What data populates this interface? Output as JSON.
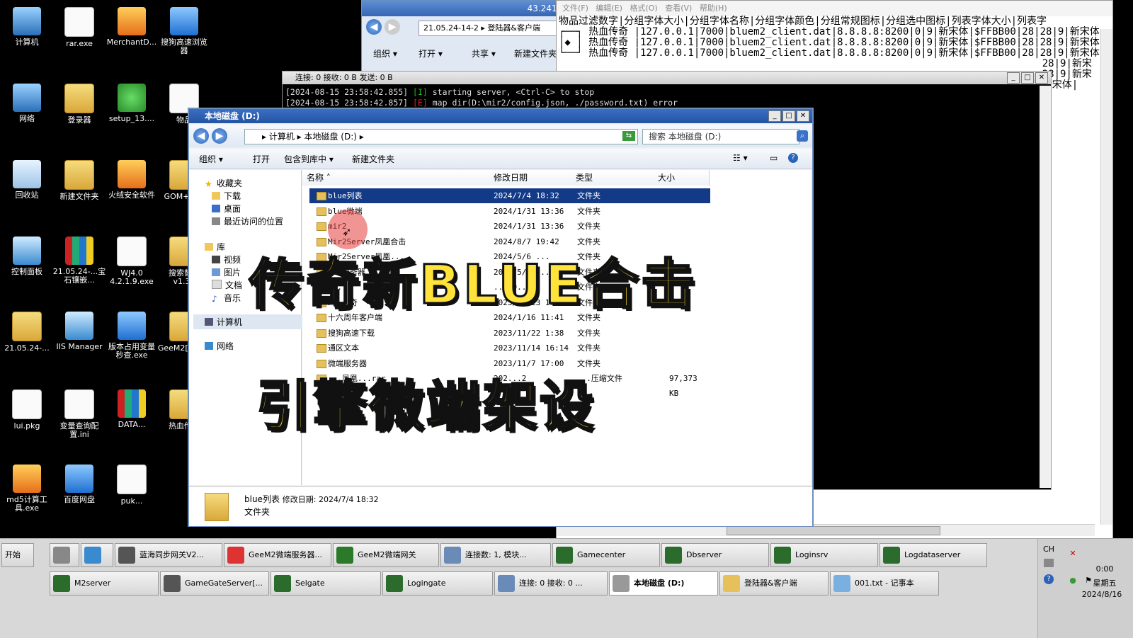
{
  "desktop_icons": [
    {
      "label": "计算机",
      "icon": "computer-icon"
    },
    {
      "label": "rar.exe",
      "icon": "exe-icon"
    },
    {
      "label": "MerchantD...",
      "icon": "app-icon"
    },
    {
      "label": "搜狗高速浏览器",
      "icon": "sogou-browser-icon"
    },
    {
      "label": "网络",
      "icon": "network-icon"
    },
    {
      "label": "登录器",
      "icon": "folder-icon"
    },
    {
      "label": "setup_13....",
      "icon": "installer-icon"
    },
    {
      "label": "物品",
      "icon": "document-icon"
    },
    {
      "label": "回收站",
      "icon": "recycle-bin-icon"
    },
    {
      "label": "新建文件夹",
      "icon": "folder-icon"
    },
    {
      "label": "火绒安全软件",
      "icon": "huorong-icon"
    },
    {
      "label": "GOM+201",
      "icon": "folder-icon"
    },
    {
      "label": "控制面板",
      "icon": "control-panel-icon"
    },
    {
      "label": "21.05.24-...宝石镶嵌...",
      "icon": "rar-icon"
    },
    {
      "label": "WJ4.0 4.2.1.9.exe",
      "icon": "yinyang-icon"
    },
    {
      "label": "搜索替换 v1.32",
      "icon": "folder-icon"
    },
    {
      "label": "21.05.24-...",
      "icon": "folder-icon"
    },
    {
      "label": "IIS Manager",
      "icon": "iis-icon"
    },
    {
      "label": "版本占用变量秒查.exe",
      "icon": "apple-icon"
    },
    {
      "label": "GeeM2[202...",
      "icon": "folder-icon"
    },
    {
      "label": "lui.pkg",
      "icon": "document-icon"
    },
    {
      "label": "变量查询配置.ini",
      "icon": "settings-file-icon"
    },
    {
      "label": "DATA...",
      "icon": "rar-icon"
    },
    {
      "label": "热血传奇",
      "icon": "folder-icon"
    },
    {
      "label": "md5计算工具.exe",
      "icon": "md5-tool-icon"
    },
    {
      "label": "百度网盘",
      "icon": "baidu-netdisk-icon"
    },
    {
      "label": "puk...",
      "icon": "document-icon"
    }
  ],
  "top_window": {
    "title": "43.241.18.125",
    "address": "21.05.24-14-2 ▸ 登陆器&客户端",
    "toolbar": [
      "组织 ▾",
      "打开 ▾",
      "共享 ▾",
      "新建文件夹"
    ]
  },
  "notepad": {
    "menu": [
      "文件(F)",
      "编辑(E)",
      "格式(O)",
      "查看(V)",
      "帮助(H)"
    ],
    "lines": [
      "物品过滤数字|分组字体大小|分组字体名称|分组字体颜色|分组常规图标|分组选中图标|列表字体大小|列表字",
      "┌──┐ 热血传奇 |127.0.0.1|7000|bluem2_client.dat|8.8.8.8:8200|0|9|新宋体|$FFBB00|28|28|9|新宋体",
      "│◆ │ 热血传奇 |127.0.0.1|7000|bluem2_client.dat|8.8.8.8:8200|0|9|新宋体|$FFBB00|28|28|9|新宋体",
      "└──┘ 热血传奇 |127.0.0.1|7000|bluem2_client.dat|8.8.8.8:8200|0|9|新宋体|$FFBB00|28|28|9|新宋体",
      "                                                                                 28|9|新宋",
      "                                                                                 28|9|新宋",
      "                                                                                 新宋体|"
    ]
  },
  "console": {
    "title": "连接: 0 接收: 0 B 发送: 0 B",
    "lines": [
      {
        "ts": "[2024-08-15 23:58:42.855]",
        "level": "[I]",
        "msg": "starting server, <Ctrl-C> to stop"
      },
      {
        "ts": "[2024-08-15 23:58:42.857]",
        "level": "[E]",
        "msg": "map dir(D:\\mir2/config.json, ./password.txt) error"
      }
    ]
  },
  "explorer": {
    "title": "本地磁盘 (D:)",
    "breadcrumb": "▸ 计算机 ▸ 本地磁盘 (D:) ▸",
    "search_placeholder": "搜索 本地磁盘 (D:)",
    "toolbar": {
      "organize": "组织 ▾",
      "open": "打开",
      "include": "包含到库中 ▾",
      "new_folder": "新建文件夹"
    },
    "nav": {
      "favorites": "收藏夹",
      "downloads": "下载",
      "desktop": "桌面",
      "recent": "最近访问的位置",
      "library": "库",
      "videos": "视频",
      "pictures": "图片",
      "documents": "文档",
      "music": "音乐",
      "computer": "计算机",
      "network": "网络"
    },
    "columns": {
      "name": "名称",
      "date": "修改日期",
      "type": "类型",
      "size": "大小"
    },
    "files": [
      {
        "name": "blue列表",
        "date": "2024/7/4 18:32",
        "type": "文件夹",
        "size": ""
      },
      {
        "name": "blue微端",
        "date": "2024/1/31 13:36",
        "type": "文件夹",
        "size": ""
      },
      {
        "name": "mir2",
        "date": "2024/1/31 13:36",
        "type": "文件夹",
        "size": ""
      },
      {
        "name": "Mir2Server凤凰合击",
        "date": "2024/8/7 19:42",
        "type": "文件夹",
        "size": ""
      },
      {
        "name": "Mir2Server凤凰...",
        "date": "2024/5/6 ...",
        "type": "文件夹",
        "size": ""
      },
      {
        "name": "...服务器",
        "date": "2024/5/6 ...",
        "type": "文件夹",
        "size": ""
      },
      {
        "name": "...",
        "date": "...10...",
        "type": "文件夹",
        "size": ""
      },
      {
        "name": "玛...奇",
        "date": "2023/12/23 15:15",
        "type": "文件夹",
        "size": ""
      },
      {
        "name": "十六周年客户端",
        "date": "2024/1/16 11:41",
        "type": "文件夹",
        "size": ""
      },
      {
        "name": "搜狗高速下载",
        "date": "2023/11/22 1:38",
        "type": "文件夹",
        "size": ""
      },
      {
        "name": "通区文本",
        "date": "2023/11/14 16:14",
        "type": "文件夹",
        "size": ""
      },
      {
        "name": "微端服务器",
        "date": "2023/11/7 17:00",
        "type": "文件夹",
        "size": ""
      },
      {
        "name": "...凤凰...rar",
        "date": "202...2",
        "type": "...压缩文件",
        "size": "97,373 KB"
      }
    ],
    "details": {
      "name": "blue列表",
      "meta": "修改日期: 2024/7/4 18:32",
      "kind": "文件夹"
    }
  },
  "overlay": {
    "line1": "传奇新BLUE合击",
    "line2": "引擎微端架设"
  },
  "taskbar": {
    "start": "开始",
    "row1": [
      {
        "label": "",
        "icon": "network-tool-icon"
      },
      {
        "label": "",
        "icon": "baidu-netdisk-icon"
      },
      {
        "label": "蓝海同步网关V2...",
        "icon": "gateway-icon"
      },
      {
        "label": "GeeM2微端服务器...",
        "icon": "dx-icon"
      },
      {
        "label": "GeeM2微端网关",
        "icon": "e-icon"
      },
      {
        "label": "连接数: 1, 模块...",
        "icon": "console-icon"
      },
      {
        "label": "Gamecenter",
        "icon": "server-icon"
      },
      {
        "label": "Dbserver",
        "icon": "server-icon"
      },
      {
        "label": "Loginsrv",
        "icon": "server-icon"
      },
      {
        "label": "Logdataserver",
        "icon": "server-icon"
      }
    ],
    "row2": [
      {
        "label": "M2server",
        "icon": "server-icon"
      },
      {
        "label": "GameGateServer[...",
        "icon": "gateway-icon"
      },
      {
        "label": "Selgate",
        "icon": "server-icon"
      },
      {
        "label": "Logingate",
        "icon": "server-icon"
      },
      {
        "label": "连接: 0 接收: 0 ...",
        "icon": "console-icon"
      },
      {
        "label": "本地磁盘 (D:)",
        "icon": "drive-icon"
      },
      {
        "label": "登陆器&客户端",
        "icon": "folder-icon"
      },
      {
        "label": "001.txt - 记事本",
        "icon": "notepad-icon"
      }
    ],
    "tray": {
      "lang": "CH",
      "time": "0:00",
      "weekday": "星期五",
      "date": "2024/8/16"
    }
  }
}
